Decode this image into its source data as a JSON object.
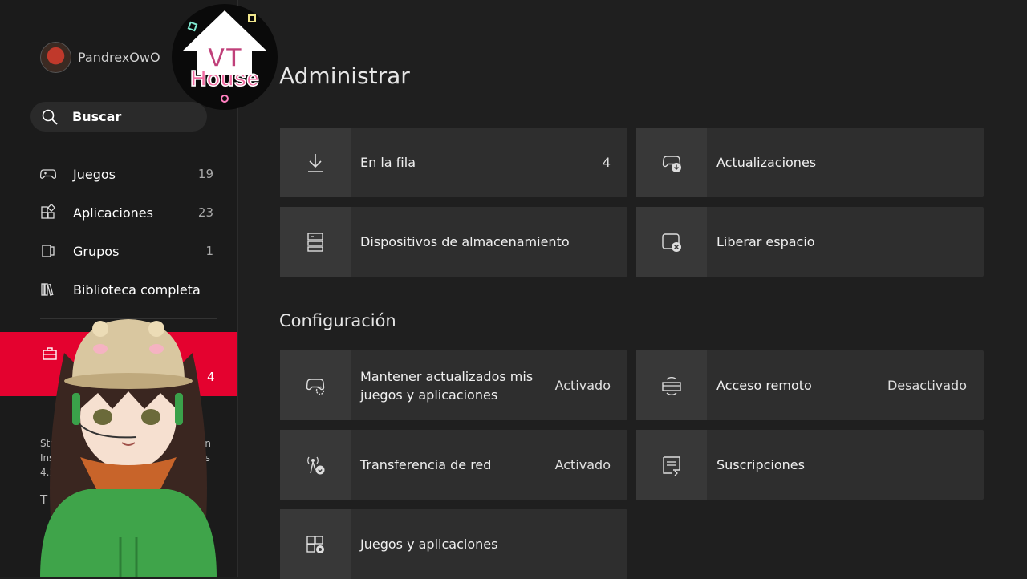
{
  "profile": {
    "gamertag": "PandrexOwO"
  },
  "search": {
    "label": "Buscar"
  },
  "sidebar": {
    "items": [
      {
        "label": "Juegos",
        "count": "19",
        "icon": "gamepad-icon"
      },
      {
        "label": "Aplicaciones",
        "count": "23",
        "icon": "apps-icon"
      },
      {
        "label": "Grupos",
        "count": "1",
        "icon": "groups-icon"
      },
      {
        "label": "Biblioteca completa",
        "count": "",
        "icon": "library-icon"
      }
    ],
    "selected": {
      "icon": "toolbox-icon",
      "count": "4"
    },
    "status_fragments": {
      "line1_left": "Stat",
      "line1_right": "on",
      "line2_left": "Ins",
      "line2_right": "ps",
      "line3_left": "4.2",
      "line4_left": "T"
    }
  },
  "main": {
    "title": "Administrar",
    "manage_tiles": [
      {
        "label": "En la fila",
        "value": "4",
        "icon": "download-icon"
      },
      {
        "label": "Actualizaciones",
        "value": "",
        "icon": "controller-update-icon"
      },
      {
        "label": "Dispositivos de almacenamiento",
        "value": "",
        "icon": "storage-icon"
      },
      {
        "label": "Liberar espacio",
        "value": "",
        "icon": "free-space-icon"
      }
    ],
    "config_title": "Configuración",
    "config_tiles": [
      {
        "label_line1": "Mantener actualizados mis",
        "label_line2": "juegos y aplicaciones",
        "value": "Activado",
        "icon": "controller-sync-icon"
      },
      {
        "label": "Acceso remoto",
        "value": "Desactivado",
        "icon": "remote-access-icon"
      },
      {
        "label": "Transferencia de red",
        "value": "Activado",
        "icon": "network-transfer-icon"
      },
      {
        "label": "Suscripciones",
        "value": "",
        "icon": "subscriptions-icon"
      },
      {
        "label": "Juegos y aplicaciones",
        "value": "",
        "icon": "games-apps-settings-icon"
      }
    ]
  },
  "overlay": {
    "logo_text_line1": "VT",
    "logo_text_line2": "House"
  },
  "colors": {
    "accent": "#e4022f",
    "background": "#1f1f1f",
    "tile": "#2e2e2e"
  }
}
